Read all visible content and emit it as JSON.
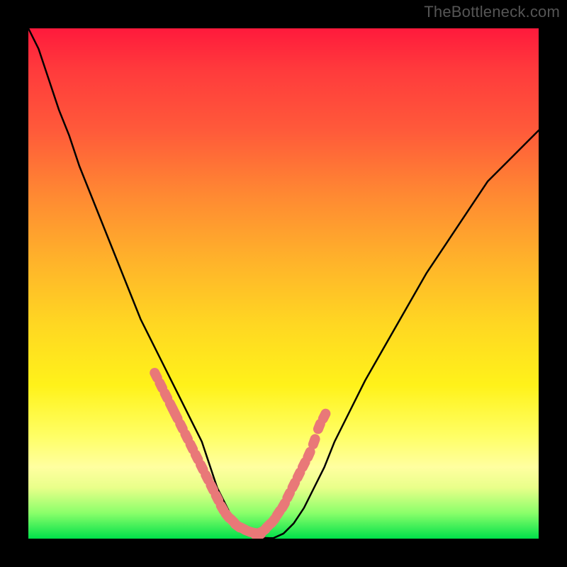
{
  "watermark": "TheBottleneck.com",
  "colors": {
    "frame_bg": "#000000",
    "marker": "#e97878",
    "curve": "#000000",
    "gradient_stops": [
      "#ff1a3c",
      "#ff5a3a",
      "#ffb42a",
      "#fff21a",
      "#ffffa0",
      "#00e04a"
    ]
  },
  "chart_data": {
    "type": "line",
    "title": "",
    "xlabel": "",
    "ylabel": "",
    "xlim": [
      0,
      100
    ],
    "ylim": [
      0,
      100
    ],
    "x": [
      0,
      2,
      4,
      6,
      8,
      10,
      12,
      14,
      16,
      18,
      20,
      22,
      24,
      26,
      28,
      30,
      32,
      34,
      35,
      36,
      37,
      38,
      39,
      40,
      41,
      42,
      43,
      44,
      46,
      48,
      50,
      52,
      54,
      56,
      58,
      60,
      63,
      66,
      70,
      74,
      78,
      82,
      86,
      90,
      94,
      98,
      100
    ],
    "values": [
      100,
      96,
      90,
      84,
      79,
      73,
      68,
      63,
      58,
      53,
      48,
      43,
      39,
      35,
      31,
      27,
      23,
      19,
      16,
      13,
      10,
      8,
      6,
      4,
      2.5,
      1.5,
      0.8,
      0.4,
      0.15,
      0.1,
      1,
      3,
      6,
      10,
      14,
      19,
      25,
      31,
      38,
      45,
      52,
      58,
      64,
      70,
      74,
      78,
      80
    ],
    "series": [
      {
        "name": "markers-left",
        "x": [
          25,
          26,
          27,
          28,
          28.5,
          29,
          30,
          31,
          32,
          33,
          34,
          35,
          36,
          37,
          38,
          39,
          40,
          41,
          42,
          43,
          44,
          45
        ],
        "values": [
          32,
          30,
          28,
          26,
          25,
          24,
          22,
          20,
          18,
          16,
          14,
          12,
          10,
          8,
          6,
          4.5,
          3.5,
          2.5,
          2,
          1.5,
          1.2,
          1
        ]
      },
      {
        "name": "markers-right",
        "x": [
          45,
          46,
          47,
          48,
          49,
          50,
          51,
          52,
          53,
          54,
          55,
          56,
          57,
          58
        ],
        "values": [
          1,
          1.5,
          2.5,
          3.5,
          5,
          6.5,
          8.5,
          10.5,
          12.5,
          14.5,
          16.5,
          19,
          22,
          24
        ]
      }
    ],
    "legend": false,
    "grid": false
  }
}
